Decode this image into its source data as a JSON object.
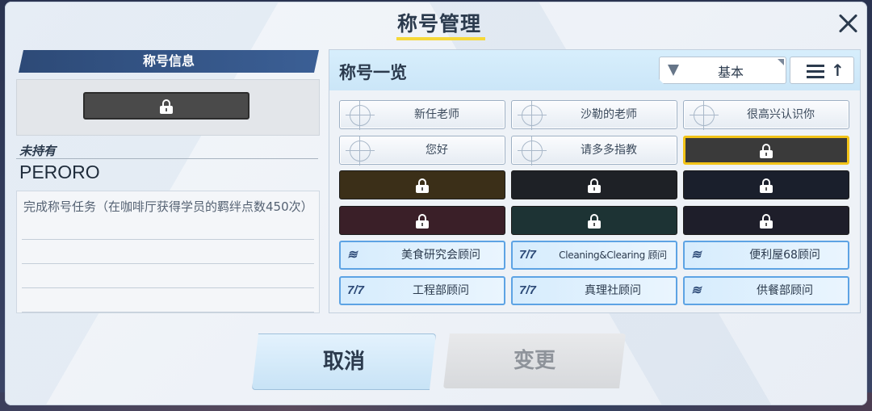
{
  "window": {
    "title": "称号管理"
  },
  "info": {
    "heading": "称号信息",
    "status": "未持有",
    "name": "PERORO",
    "description": "完成称号任务（在咖啡厅获得学员的羁绊点数450次）"
  },
  "list": {
    "heading": "称号一览",
    "filter_label": "基本",
    "sort_arrow": "↑",
    "items": [
      {
        "kind": "plain",
        "label": "新任老师"
      },
      {
        "kind": "plain",
        "label": "沙勒的老师"
      },
      {
        "kind": "plain",
        "label": "很高兴认识你"
      },
      {
        "kind": "plain",
        "label": "您好"
      },
      {
        "kind": "plain",
        "label": "请多多指教"
      },
      {
        "kind": "locked",
        "label": "",
        "color": "#3a3a3a",
        "selected": true
      },
      {
        "kind": "locked",
        "label": "",
        "color": "#3b2f18"
      },
      {
        "kind": "locked",
        "label": "",
        "color": "#1e2126"
      },
      {
        "kind": "locked",
        "label": "",
        "color": "#1a1f2c"
      },
      {
        "kind": "locked",
        "label": "",
        "color": "#3a1f28"
      },
      {
        "kind": "locked",
        "label": "",
        "color": "#1d3334"
      },
      {
        "kind": "locked",
        "label": "",
        "color": "#1e1e2a"
      },
      {
        "kind": "club",
        "label": "美食研究会顾问",
        "logo": "≋"
      },
      {
        "kind": "club",
        "label": "Cleaning&Clearing 顾问",
        "logo": "7/7"
      },
      {
        "kind": "club",
        "label": "便利屋68顾问",
        "logo": "≋"
      },
      {
        "kind": "club",
        "label": "工程部顾问",
        "logo": "7/7"
      },
      {
        "kind": "club",
        "label": "真理社顾问",
        "logo": "7/7"
      },
      {
        "kind": "club",
        "label": "供餐部顾问",
        "logo": "≋"
      }
    ]
  },
  "buttons": {
    "cancel": "取消",
    "change": "变更"
  },
  "colors": {
    "accent_yellow": "#f2c318",
    "header_blue": "#2d4a77",
    "club_border": "#5da3e4"
  },
  "icons": {
    "close": "close-icon",
    "filter": "filter-icon",
    "sort": "sort-icon",
    "lock": "lock-icon"
  }
}
